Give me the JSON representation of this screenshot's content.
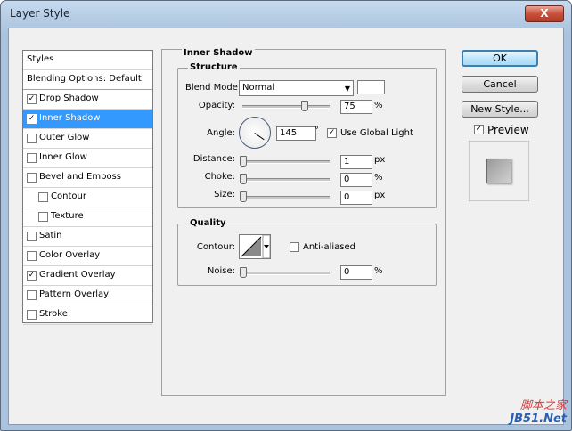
{
  "window": {
    "title": "Layer Style",
    "close_glyph": "X"
  },
  "styles_list": {
    "header": "Styles",
    "blending": "Blending Options: Default",
    "items": [
      {
        "label": "Drop Shadow",
        "checked": true,
        "selected": false
      },
      {
        "label": "Inner Shadow",
        "checked": true,
        "selected": true
      },
      {
        "label": "Outer Glow",
        "checked": false,
        "selected": false
      },
      {
        "label": "Inner Glow",
        "checked": false,
        "selected": false
      },
      {
        "label": "Bevel and Emboss",
        "checked": false,
        "selected": false
      },
      {
        "label": "Contour",
        "checked": false,
        "selected": false
      },
      {
        "label": "Texture",
        "checked": false,
        "selected": false
      },
      {
        "label": "Satin",
        "checked": false,
        "selected": false
      },
      {
        "label": "Color Overlay",
        "checked": false,
        "selected": false
      },
      {
        "label": "Gradient Overlay",
        "checked": true,
        "selected": false
      },
      {
        "label": "Pattern Overlay",
        "checked": false,
        "selected": false
      },
      {
        "label": "Stroke",
        "checked": false,
        "selected": false
      }
    ]
  },
  "panel": {
    "title": "Inner Shadow",
    "structure": {
      "title": "Structure",
      "blend_mode_label": "Blend Mode:",
      "blend_mode_value": "Normal",
      "opacity_label": "Opacity:",
      "opacity_value": "75",
      "angle_label": "Angle:",
      "angle_value": "145",
      "degree_symbol": "°",
      "use_global_light_label": "Use Global Light",
      "use_global_light": true,
      "distance_label": "Distance:",
      "distance_value": "1",
      "choke_label": "Choke:",
      "choke_value": "0",
      "size_label": "Size:",
      "size_value": "0",
      "unit_percent": "%",
      "unit_px": "px"
    },
    "quality": {
      "title": "Quality",
      "contour_label": "Contour:",
      "anti_aliased_label": "Anti-aliased",
      "anti_aliased": false,
      "noise_label": "Noise:",
      "noise_value": "0",
      "unit_percent": "%"
    }
  },
  "buttons": {
    "ok": "OK",
    "cancel": "Cancel",
    "new_style": "New Style..."
  },
  "preview": {
    "label": "Preview",
    "checked": true
  },
  "watermark": {
    "line1": "脚本之家",
    "line2": "JB51.Net"
  },
  "colors": {
    "selection": "#3399ff",
    "title_bar": "#b5cce4",
    "close": "#c9513c"
  }
}
